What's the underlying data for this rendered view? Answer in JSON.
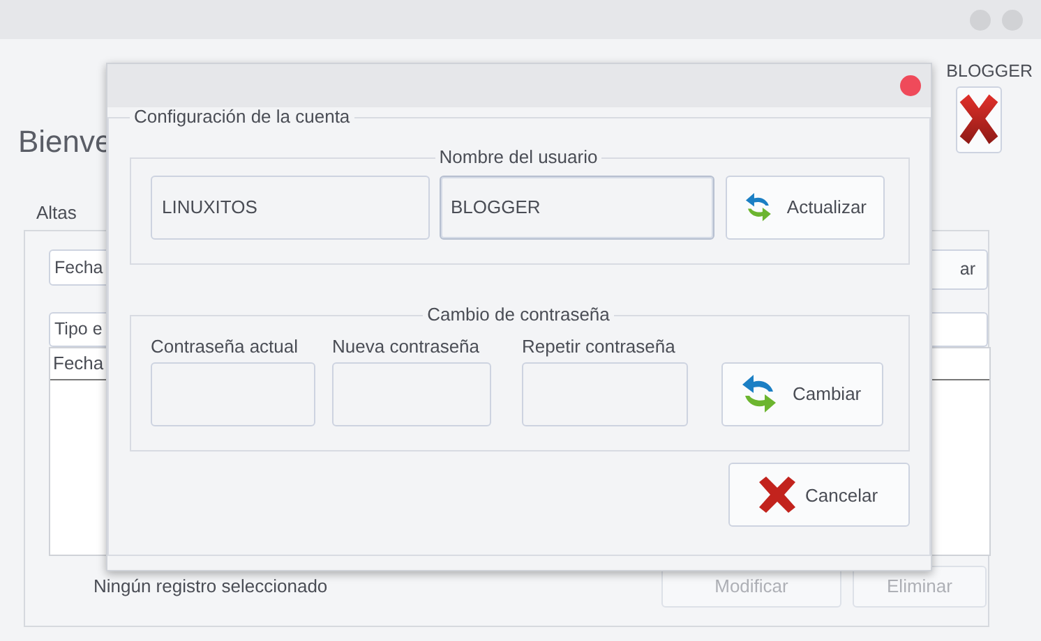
{
  "header": {
    "greeting": "Bienve",
    "user": "BLOGGER"
  },
  "tabs": [
    {
      "label": "Altas",
      "selected": true
    }
  ],
  "form": {
    "date_field": {
      "value": "Fecha"
    },
    "action_button": "ar",
    "type_field": {
      "value": "Tipo e"
    }
  },
  "table": {
    "columns": [
      "Fecha"
    ]
  },
  "status": "Ningún registro seleccionado",
  "buttons": [
    {
      "label": "Modificar",
      "disabled": true
    },
    {
      "label": "Eliminar",
      "disabled": true
    }
  ],
  "dialog": {
    "title": "Configuración de la cuenta",
    "username": {
      "legend": "Nombre del usuario",
      "first_name": "LINUXITOS",
      "last_name": "BLOGGER",
      "focused": true,
      "button": "Actualizar"
    },
    "password": {
      "legend": "Cambio de contraseña",
      "fields": [
        {
          "label": "Contraseña actual"
        },
        {
          "label": "Nueva contraseña"
        },
        {
          "label": "Repetir contraseña"
        }
      ],
      "button": "Cambiar"
    },
    "cancel": "Cancelar"
  }
}
